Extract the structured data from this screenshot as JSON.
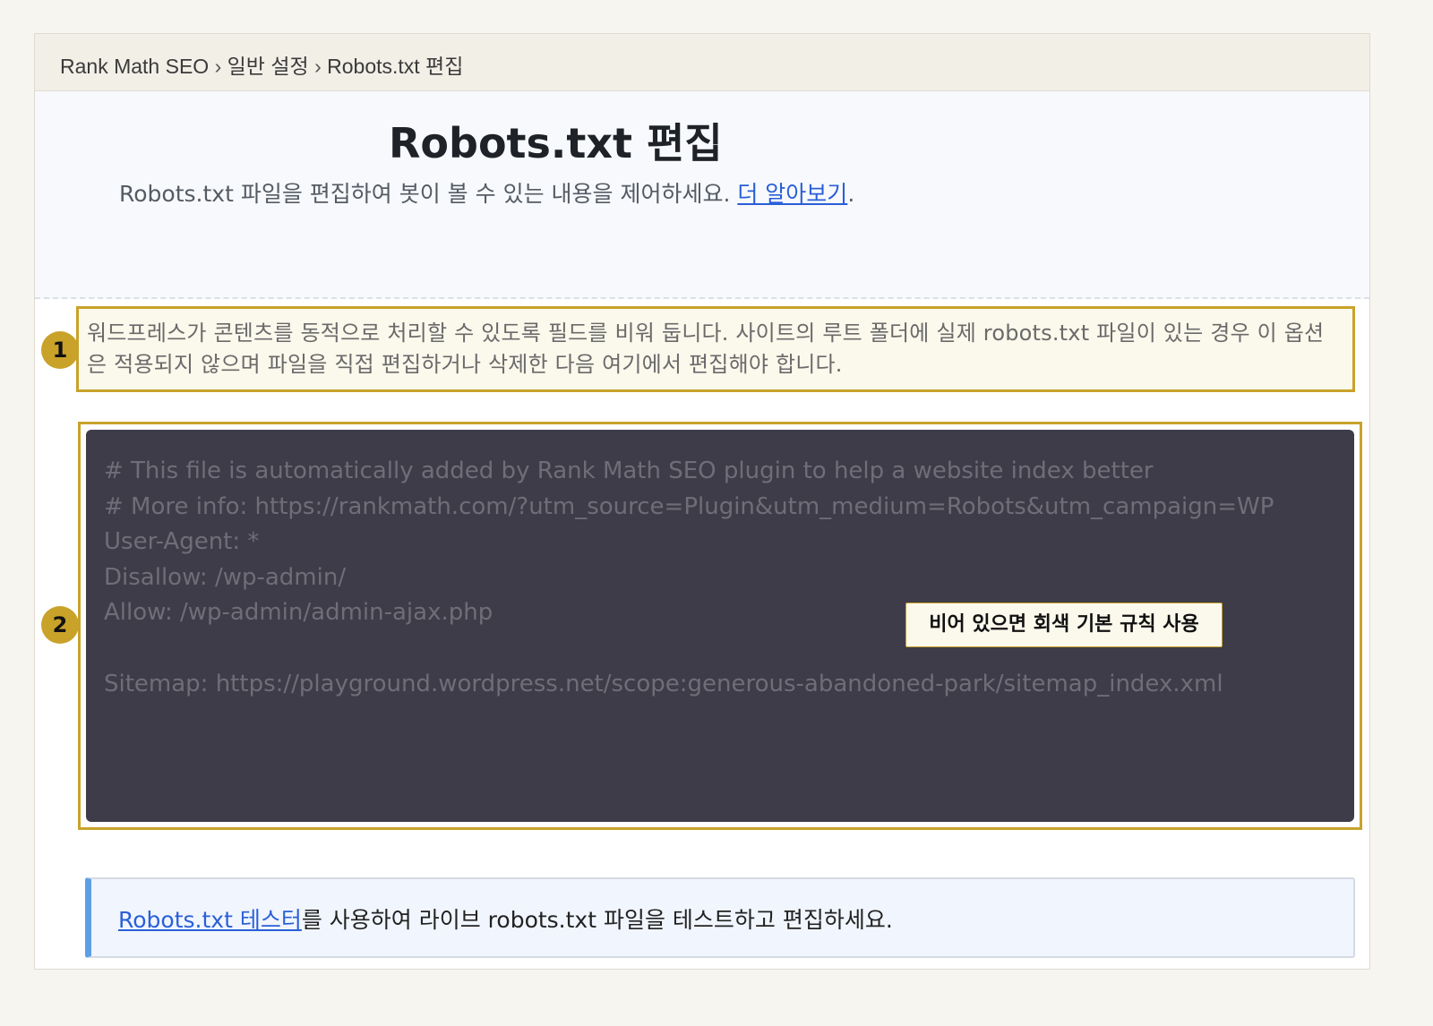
{
  "breadcrumb": {
    "items": [
      "Rank Math SEO",
      "일반 설정",
      "Robots.txt 편집"
    ],
    "separator": "›"
  },
  "header": {
    "title": "Robots.txt 편집",
    "description": "Robots.txt 파일을 편집하여 봇이 볼 수 있는 내용을 제어하세요.",
    "learn_more_link": "더 알아보기",
    "desc_end": "."
  },
  "callout1": {
    "number": "1",
    "text": "워드프레스가 콘텐츠를 동적으로 처리할 수 있도록 필드를 비워 둡니다. 사이트의 루트 폴더에 실제 robots.txt 파일이 있는 경우 이 옵션은 적용되지 않으며 파일을 직접 편집하거나 삭제한 다음 여기에서 편집해야 합니다."
  },
  "callout2": {
    "number": "2",
    "tooltip": "비어 있으면 회색 기본 규칙 사용"
  },
  "editor": {
    "placeholder_lines": [
      "# This file is automatically added by Rank Math SEO plugin to help a website index better",
      "# More info: https://rankmath.com/?utm_source=Plugin&utm_medium=Robots&utm_campaign=WP",
      "User-Agent: *",
      "Disallow: /wp-admin/",
      "Allow: /wp-admin/admin-ajax.php",
      "",
      "Sitemap: https://playground.wordpress.net/scope:generous-abandoned-park/sitemap_index.xml"
    ]
  },
  "notice": {
    "link": "Robots.txt 테스터",
    "text": "를 사용하여 라이브 robots.txt 파일을 테스트하고 편집하세요."
  },
  "colors": {
    "accent_gold": "#c9a22a",
    "editor_bg": "#3d3c48",
    "link_blue": "#2a5fd8",
    "notice_border": "#5b9fe6"
  }
}
